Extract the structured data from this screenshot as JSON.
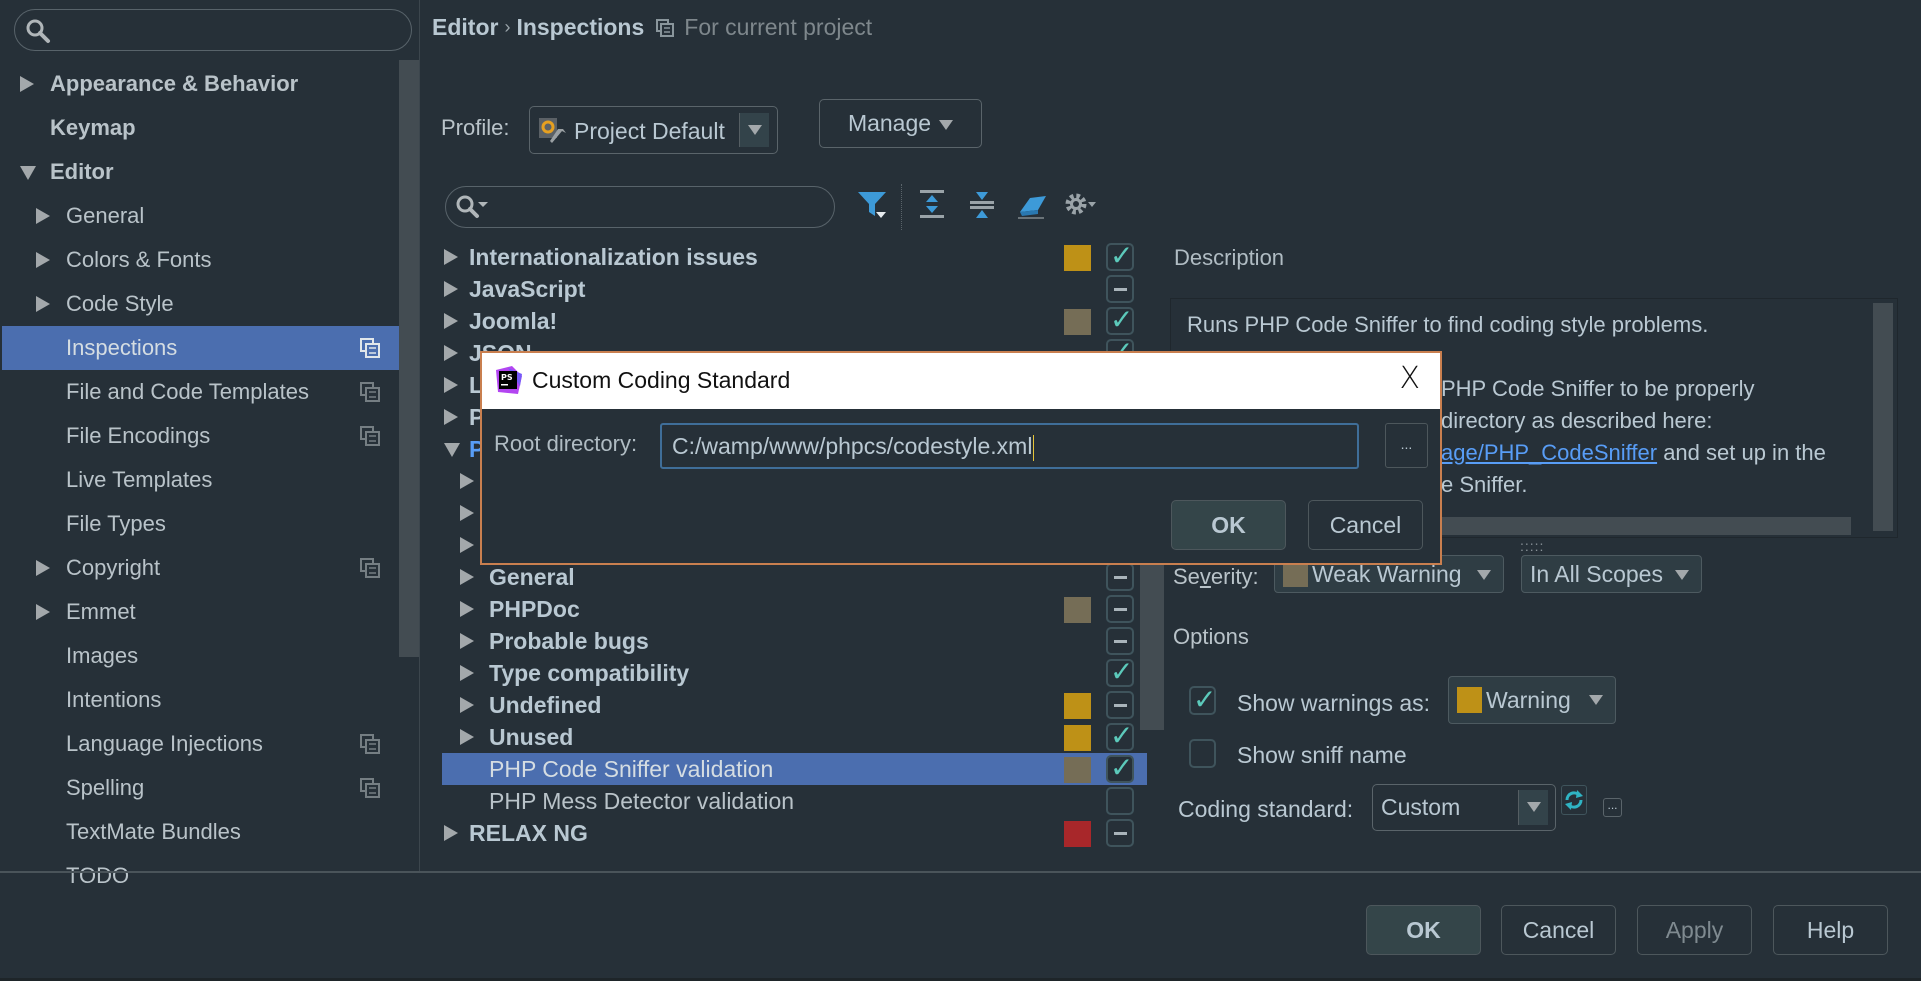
{
  "sidebar": {
    "search_placeholder": "",
    "items": [
      {
        "label": "Appearance & Behavior",
        "level": 0,
        "bold": true,
        "arrow": "right",
        "project": false
      },
      {
        "label": "Keymap",
        "level": 0,
        "bold": true,
        "arrow": "none",
        "project": false
      },
      {
        "label": "Editor",
        "level": 0,
        "bold": true,
        "arrow": "down",
        "project": false
      },
      {
        "label": "General",
        "level": 1,
        "bold": false,
        "arrow": "right",
        "project": false
      },
      {
        "label": "Colors & Fonts",
        "level": 1,
        "bold": false,
        "arrow": "right",
        "project": false
      },
      {
        "label": "Code Style",
        "level": 1,
        "bold": false,
        "arrow": "right",
        "project": false
      },
      {
        "label": "Inspections",
        "level": 1,
        "bold": false,
        "arrow": "none",
        "project": true,
        "selected": true
      },
      {
        "label": "File and Code Templates",
        "level": 1,
        "bold": false,
        "arrow": "none",
        "project": true
      },
      {
        "label": "File Encodings",
        "level": 1,
        "bold": false,
        "arrow": "none",
        "project": true
      },
      {
        "label": "Live Templates",
        "level": 1,
        "bold": false,
        "arrow": "none",
        "project": false
      },
      {
        "label": "File Types",
        "level": 1,
        "bold": false,
        "arrow": "none",
        "project": false
      },
      {
        "label": "Copyright",
        "level": 1,
        "bold": false,
        "arrow": "right",
        "project": true
      },
      {
        "label": "Emmet",
        "level": 1,
        "bold": false,
        "arrow": "right",
        "project": false
      },
      {
        "label": "Images",
        "level": 1,
        "bold": false,
        "arrow": "none",
        "project": false
      },
      {
        "label": "Intentions",
        "level": 1,
        "bold": false,
        "arrow": "none",
        "project": false
      },
      {
        "label": "Language Injections",
        "level": 1,
        "bold": false,
        "arrow": "none",
        "project": true
      },
      {
        "label": "Spelling",
        "level": 1,
        "bold": false,
        "arrow": "none",
        "project": true
      },
      {
        "label": "TextMate Bundles",
        "level": 1,
        "bold": false,
        "arrow": "none",
        "project": false
      },
      {
        "label": "TODO",
        "level": 1,
        "bold": false,
        "arrow": "none",
        "project": false
      }
    ]
  },
  "header": {
    "breadcrumb": [
      "Editor",
      "Inspections"
    ],
    "breadcrumb_sep": "›",
    "scope_hint": "For current project"
  },
  "profile": {
    "label": "Profile:",
    "value": "Project Default",
    "manage_label": "Manage"
  },
  "inspections": {
    "search_placeholder": "",
    "rows": [
      {
        "label": "Internationalization issues",
        "level": 0,
        "bold": true,
        "arrow": "right",
        "severity_color": "#be9117",
        "state": "checked"
      },
      {
        "label": "JavaScript",
        "level": 0,
        "bold": true,
        "arrow": "right",
        "severity_color": null,
        "state": "partial"
      },
      {
        "label": "Joomla!",
        "level": 0,
        "bold": true,
        "arrow": "right",
        "severity_color": "#756d56",
        "state": "checked"
      },
      {
        "label": "JSON",
        "level": 0,
        "bold": true,
        "arrow": "right",
        "severity_color": null,
        "state": "checked"
      },
      {
        "label": "L",
        "level": 0,
        "bold": true,
        "arrow": "right",
        "severity_color": null,
        "state": "none"
      },
      {
        "label": "P",
        "level": 0,
        "bold": true,
        "arrow": "right",
        "severity_color": null,
        "state": "none"
      },
      {
        "label": "P",
        "level": 0,
        "bold": true,
        "arrow": "down",
        "severity_color": null,
        "state": "none",
        "highlight": true
      },
      {
        "label": "",
        "level": 1,
        "bold": true,
        "arrow": "right",
        "severity_color": null,
        "state": "none"
      },
      {
        "label": "",
        "level": 1,
        "bold": true,
        "arrow": "right",
        "severity_color": null,
        "state": "none"
      },
      {
        "label": "",
        "level": 1,
        "bold": true,
        "arrow": "right",
        "severity_color": null,
        "state": "none"
      },
      {
        "label": "General",
        "level": 1,
        "bold": true,
        "arrow": "right",
        "severity_color": null,
        "state": "partial"
      },
      {
        "label": "PHPDoc",
        "level": 1,
        "bold": true,
        "arrow": "right",
        "severity_color": "#756d56",
        "state": "partial"
      },
      {
        "label": "Probable bugs",
        "level": 1,
        "bold": true,
        "arrow": "right",
        "severity_color": null,
        "state": "partial"
      },
      {
        "label": "Type compatibility",
        "level": 1,
        "bold": true,
        "arrow": "right",
        "severity_color": null,
        "state": "checked"
      },
      {
        "label": "Undefined",
        "level": 1,
        "bold": true,
        "arrow": "right",
        "severity_color": "#be9117",
        "state": "partial"
      },
      {
        "label": "Unused",
        "level": 1,
        "bold": true,
        "arrow": "right",
        "severity_color": "#be9117",
        "state": "checked"
      },
      {
        "label": "PHP Code Sniffer validation",
        "level": 1,
        "bold": false,
        "arrow": "none",
        "severity_color": "#756d56",
        "state": "checked",
        "selected": true
      },
      {
        "label": "PHP Mess Detector validation",
        "level": 1,
        "bold": false,
        "arrow": "none",
        "severity_color": null,
        "state": "unchecked"
      },
      {
        "label": "RELAX NG",
        "level": 0,
        "bold": true,
        "arrow": "right",
        "severity_color": "#a8272a",
        "state": "partial"
      }
    ]
  },
  "description": {
    "title": "Description",
    "line1": "Runs PHP Code Sniffer to find coding style problems.",
    "para2_a": "PHP Code Sniffer to be properly",
    "para2_b": "directory as described here:",
    "link": "age/PHP_CodeSniffer",
    "para2_c": " and set up in the",
    "para2_d": "e Sniffer."
  },
  "severity": {
    "label_pre": "Se",
    "label_u": "v",
    "label_post": "erity:",
    "value": "Weak Warning",
    "value_color": "#756d56",
    "scope": "In All Scopes"
  },
  "options": {
    "title": "Options",
    "show_warnings_label": "Show warnings as:",
    "show_warnings_checked": true,
    "warning_value": "Warning",
    "warning_color": "#be9117",
    "show_sniff_label": "Show sniff name",
    "show_sniff_checked": false,
    "coding_standard_label": "Coding standard:",
    "coding_standard_value": "Custom",
    "dots": "..."
  },
  "footer": {
    "ok": "OK",
    "cancel": "Cancel",
    "apply": "Apply",
    "help": "Help"
  },
  "dialog": {
    "title": "Custom Coding Standard",
    "close": "X",
    "root_label": "Root directory:",
    "root_value": "C:/wamp/www/phpcs/codestyle.xml",
    "browse": "...",
    "ok": "OK",
    "cancel": "Cancel"
  }
}
